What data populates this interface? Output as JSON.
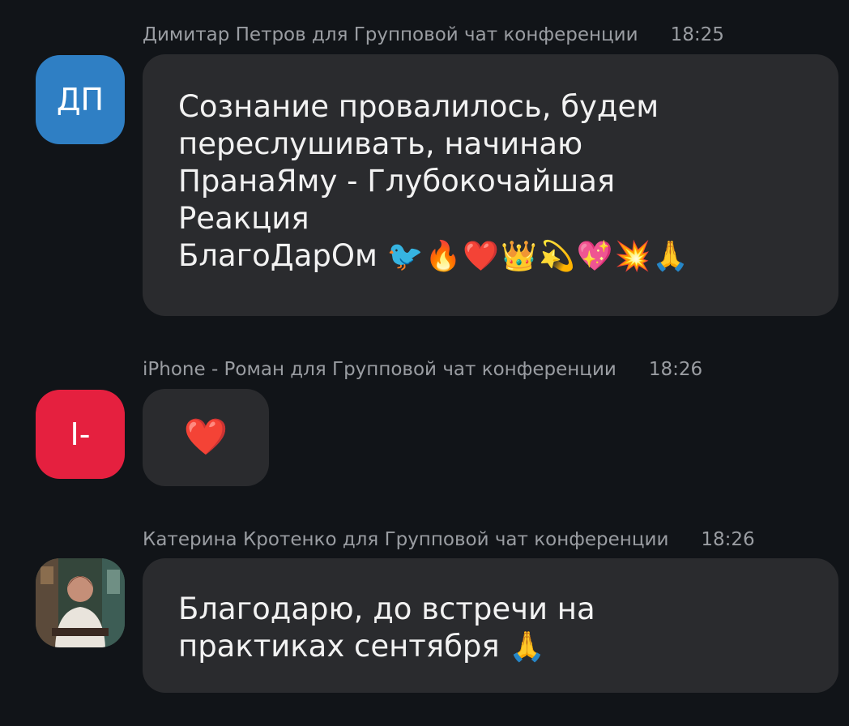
{
  "messages": [
    {
      "sender_line": "Димитар Петров для Групповой чат конференции",
      "time": "18:25",
      "avatar_initials": "ДП",
      "avatar_color": "#2f7fc4",
      "text": "Сознание провалилось, будем\nпереслушивать, начинаю\nПранаЯму - Глубокочайшая\nРеакция\nБлагоДарОм",
      "emojis": "🐦🔥❤️👑💫💖💥🙏"
    },
    {
      "sender_line": "iPhone - Роман для Групповой чат конференции",
      "time": "18:26",
      "avatar_initials": "I-",
      "avatar_color": "#e5203f",
      "text": "❤️"
    },
    {
      "sender_line": "Катерина Кротенко для Групповой чат конференции",
      "time": "18:26",
      "avatar_type": "photo",
      "text": "Благодарю, до встречи на\nпрактиках сентября",
      "emojis": "🙏"
    }
  ]
}
